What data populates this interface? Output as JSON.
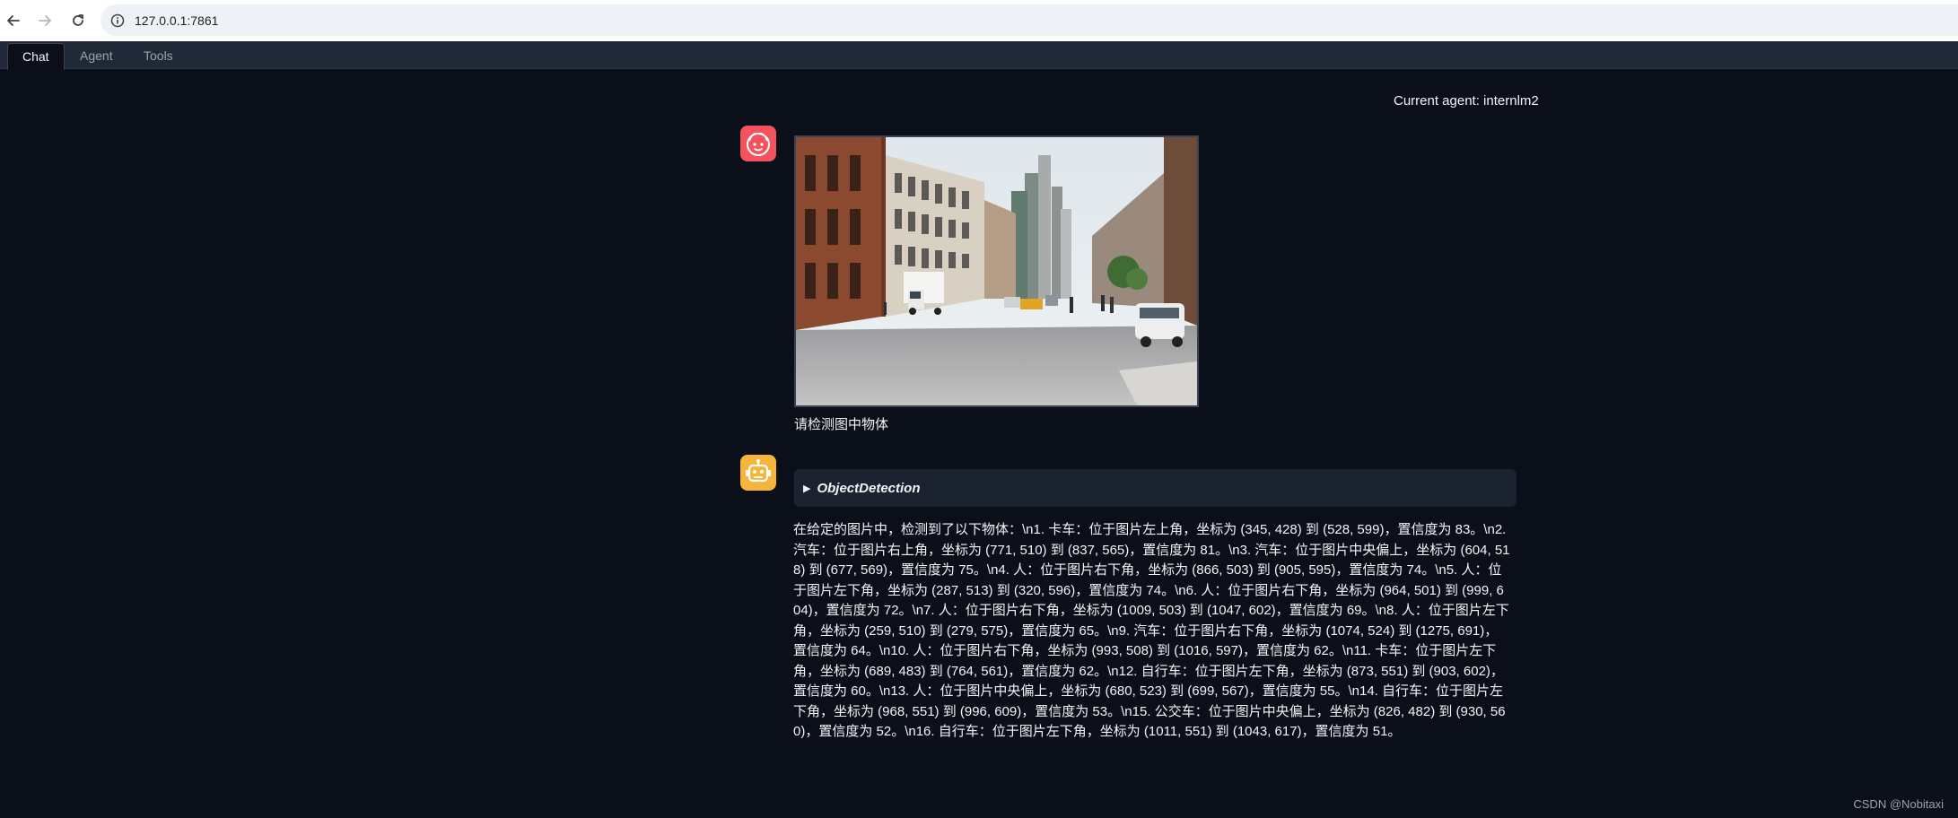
{
  "browser": {
    "url": "127.0.0.1:7861",
    "icons": [
      "back-arrow-icon",
      "forward-arrow-icon",
      "reload-icon",
      "site-info-icon"
    ]
  },
  "tabs": [
    {
      "label": "Chat",
      "active": true
    },
    {
      "label": "Agent",
      "active": false
    },
    {
      "label": "Tools",
      "active": false
    }
  ],
  "agent_status": "Current agent: internlm2",
  "conversation": {
    "user_message": {
      "avatar": "user-face-icon",
      "avatar_color": "#f4525e",
      "image": "street-scene-photo",
      "text": "请检测图中物体"
    },
    "bot_message": {
      "avatar": "robot-icon",
      "avatar_color": "#f6b53a",
      "tool_name": "ObjectDetection",
      "text": "在给定的图片中，检测到了以下物体：\\n1. 卡车：位于图片左上角，坐标为 (345, 428) 到 (528, 599)，置信度为 83。\\n2. 汽车：位于图片右上角，坐标为 (771, 510) 到 (837, 565)，置信度为 81。\\n3. 汽车：位于图片中央偏上，坐标为 (604, 518) 到 (677, 569)，置信度为 75。\\n4. 人：位于图片右下角，坐标为 (866, 503) 到 (905, 595)，置信度为 74。\\n5. 人：位于图片左下角，坐标为 (287, 513) 到 (320, 596)，置信度为 74。\\n6. 人：位于图片右下角，坐标为 (964, 501) 到 (999, 604)，置信度为 72。\\n7. 人：位于图片右下角，坐标为 (1009, 503) 到 (1047, 602)，置信度为 69。\\n8. 人：位于图片左下角，坐标为 (259, 510) 到 (279, 575)，置信度为 65。\\n9. 汽车：位于图片右下角，坐标为 (1074, 524) 到 (1275, 691)，置信度为 64。\\n10. 人：位于图片右下角，坐标为 (993, 508) 到 (1016, 597)，置信度为 62。\\n11. 卡车：位于图片左下角，坐标为 (689, 483) 到 (764, 561)，置信度为 62。\\n12. 自行车：位于图片左下角，坐标为 (873, 551) 到 (903, 602)，置信度为 60。\\n13. 人：位于图片中央偏上，坐标为 (680, 523) 到 (699, 567)，置信度为 55。\\n14. 自行车：位于图片左下角，坐标为 (968, 551) 到 (996, 609)，置信度为 53。\\n15. 公交车：位于图片中央偏上，坐标为 (826, 482) 到 (930, 560)，置信度为 52。\\n16. 自行车：位于图片左下角，坐标为 (1011, 551) 到 (1043, 617)，置信度为 51。"
    }
  },
  "watermark": "CSDN @Nobitaxi"
}
